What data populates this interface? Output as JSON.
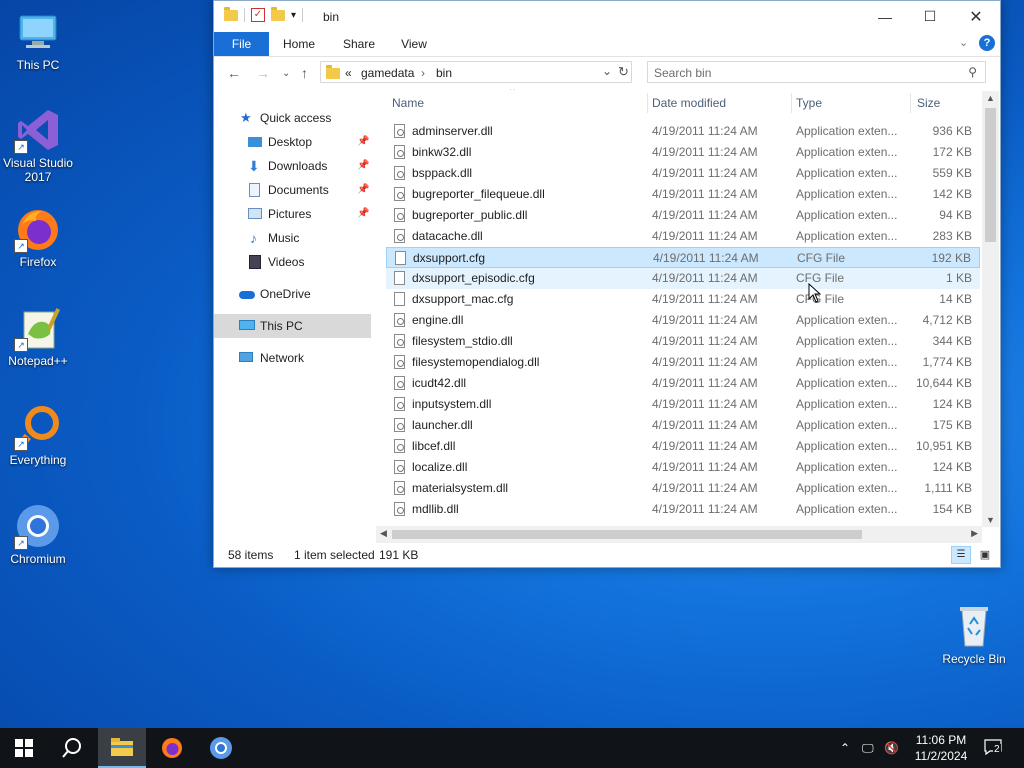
{
  "desktop": {
    "icons": [
      {
        "label": "This PC"
      },
      {
        "label": "Visual Studio 2017"
      },
      {
        "label": "Firefox"
      },
      {
        "label": "Notepad++"
      },
      {
        "label": "Everything"
      },
      {
        "label": "Chromium"
      },
      {
        "label": "Recycle Bin"
      }
    ]
  },
  "window": {
    "title": "bin",
    "tabs": [
      "File",
      "Home",
      "Share",
      "View"
    ],
    "address": {
      "prefix": "«",
      "path": [
        "gamedata",
        "bin"
      ]
    },
    "search": {
      "placeholder": "Search bin"
    },
    "nav": {
      "quick_access": "Quick access",
      "items": [
        {
          "label": "Desktop",
          "pinned": true
        },
        {
          "label": "Downloads",
          "pinned": true
        },
        {
          "label": "Documents",
          "pinned": true
        },
        {
          "label": "Pictures",
          "pinned": true
        },
        {
          "label": "Music",
          "pinned": false
        },
        {
          "label": "Videos",
          "pinned": false
        }
      ],
      "onedrive": "OneDrive",
      "thispc": "This PC",
      "network": "Network"
    },
    "columns": {
      "name": "Name",
      "date": "Date modified",
      "type": "Type",
      "size": "Size"
    },
    "files": [
      {
        "name": "adminserver.dll",
        "date": "4/19/2011 11:24 AM",
        "type": "Application exten...",
        "size": "936 KB",
        "kind": "dll"
      },
      {
        "name": "binkw32.dll",
        "date": "4/19/2011 11:24 AM",
        "type": "Application exten...",
        "size": "172 KB",
        "kind": "dll"
      },
      {
        "name": "bsppack.dll",
        "date": "4/19/2011 11:24 AM",
        "type": "Application exten...",
        "size": "559 KB",
        "kind": "dll"
      },
      {
        "name": "bugreporter_filequeue.dll",
        "date": "4/19/2011 11:24 AM",
        "type": "Application exten...",
        "size": "142 KB",
        "kind": "dll"
      },
      {
        "name": "bugreporter_public.dll",
        "date": "4/19/2011 11:24 AM",
        "type": "Application exten...",
        "size": "94 KB",
        "kind": "dll"
      },
      {
        "name": "datacache.dll",
        "date": "4/19/2011 11:24 AM",
        "type": "Application exten...",
        "size": "283 KB",
        "kind": "dll"
      },
      {
        "name": "dxsupport.cfg",
        "date": "4/19/2011 11:24 AM",
        "type": "CFG File",
        "size": "192 KB",
        "kind": "cfg"
      },
      {
        "name": "dxsupport_episodic.cfg",
        "date": "4/19/2011 11:24 AM",
        "type": "CFG File",
        "size": "1 KB",
        "kind": "cfg"
      },
      {
        "name": "dxsupport_mac.cfg",
        "date": "4/19/2011 11:24 AM",
        "type": "CFG File",
        "size": "14 KB",
        "kind": "cfg"
      },
      {
        "name": "engine.dll",
        "date": "4/19/2011 11:24 AM",
        "type": "Application exten...",
        "size": "4,712 KB",
        "kind": "dll"
      },
      {
        "name": "filesystem_stdio.dll",
        "date": "4/19/2011 11:24 AM",
        "type": "Application exten...",
        "size": "344 KB",
        "kind": "dll"
      },
      {
        "name": "filesystemopendialog.dll",
        "date": "4/19/2011 11:24 AM",
        "type": "Application exten...",
        "size": "1,774 KB",
        "kind": "dll"
      },
      {
        "name": "icudt42.dll",
        "date": "4/19/2011 11:24 AM",
        "type": "Application exten...",
        "size": "10,644 KB",
        "kind": "dll"
      },
      {
        "name": "inputsystem.dll",
        "date": "4/19/2011 11:24 AM",
        "type": "Application exten...",
        "size": "124 KB",
        "kind": "dll"
      },
      {
        "name": "launcher.dll",
        "date": "4/19/2011 11:24 AM",
        "type": "Application exten...",
        "size": "175 KB",
        "kind": "dll"
      },
      {
        "name": "libcef.dll",
        "date": "4/19/2011 11:24 AM",
        "type": "Application exten...",
        "size": "10,951 KB",
        "kind": "dll"
      },
      {
        "name": "localize.dll",
        "date": "4/19/2011 11:24 AM",
        "type": "Application exten...",
        "size": "124 KB",
        "kind": "dll"
      },
      {
        "name": "materialsystem.dll",
        "date": "4/19/2011 11:24 AM",
        "type": "Application exten...",
        "size": "1,111 KB",
        "kind": "dll"
      },
      {
        "name": "mdllib.dll",
        "date": "4/19/2011 11:24 AM",
        "type": "Application exten...",
        "size": "154 KB",
        "kind": "dll"
      }
    ],
    "selected_index": 6,
    "hover_index": 7,
    "status": {
      "count": "58 items",
      "selection": "1 item selected",
      "size": "191 KB"
    }
  },
  "taskbar": {
    "time": "11:06 PM",
    "date": "11/2/2024",
    "notifications": "2"
  },
  "colors": {
    "accent": "#1a6fd6",
    "selection": "#cce8ff",
    "taskbar": "#101418"
  }
}
